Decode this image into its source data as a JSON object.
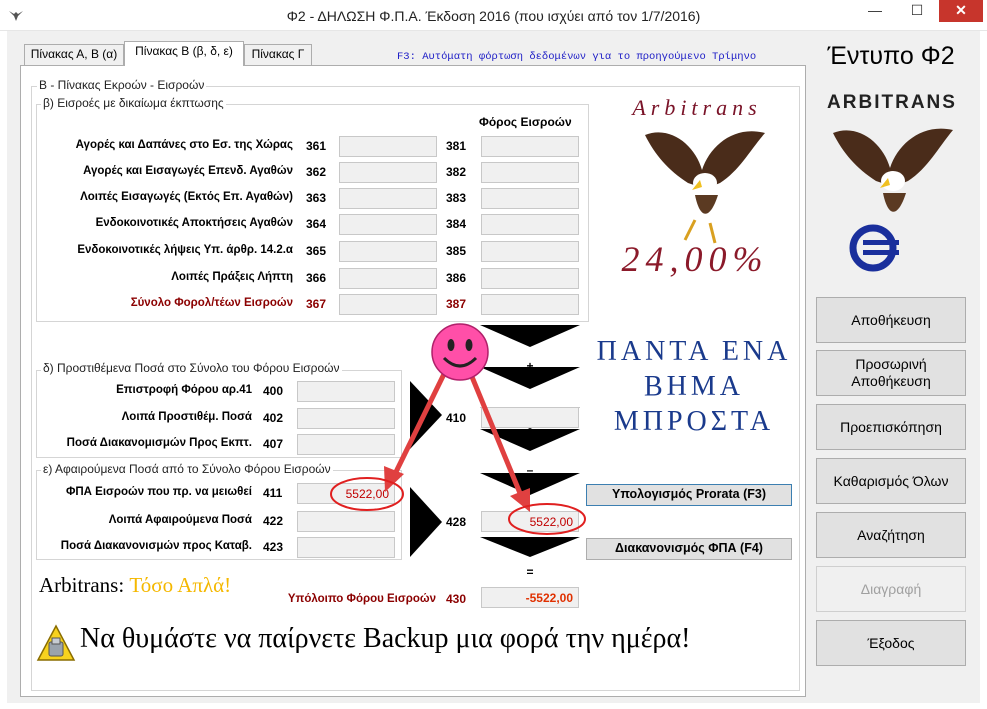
{
  "window": {
    "title": "Φ2 - ΔΗΛΩΣΗ Φ.Π.Α. Έκδοση 2016 (που ισχύει από τον 1/7/2016)",
    "minimize": "—",
    "maximize": "☐",
    "close": "✕"
  },
  "tabs": [
    {
      "label": "Πίνακας Α, Β (α)"
    },
    {
      "label": "Πίνακας Β (β, δ, ε)"
    },
    {
      "label": "Πίνακας Γ"
    }
  ],
  "hint": "F3: Αυτόματη φόρτωση δεδομένων για το προηγούμενο Τρίμηνο",
  "form_title": "Έντυπο Φ2",
  "brand": "ARBITRANS",
  "main_group_label": "Β - Πίνακας Εκροών - Εισροών",
  "section_b": {
    "label": "β) Εισροές με δικαίωμα έκπτωσης",
    "tax_header": "Φόρος Εισροών",
    "rows": [
      {
        "label": "Αγορές και Δαπάνες στο Εσ. της Χώρας",
        "code": "361",
        "value": "",
        "tax_code": "381",
        "tax": ""
      },
      {
        "label": "Αγορές και Εισαγωγές Επενδ. Αγαθών",
        "code": "362",
        "value": "",
        "tax_code": "382",
        "tax": ""
      },
      {
        "label": "Λοιπές Εισαγωγές (Εκτός Επ. Αγαθών)",
        "code": "363",
        "value": "",
        "tax_code": "383",
        "tax": ""
      },
      {
        "label": "Ενδοκοινοτικές Αποκτήσεις Αγαθών",
        "code": "364",
        "value": "",
        "tax_code": "384",
        "tax": ""
      },
      {
        "label": "Ενδοκοινοτικές λήψεις Υπ. άρθρ. 14.2.α",
        "code": "365",
        "value": "",
        "tax_code": "385",
        "tax": ""
      },
      {
        "label": "Λοιπές Πράξεις Λήπτη",
        "code": "366",
        "value": "",
        "tax_code": "386",
        "tax": ""
      }
    ],
    "total": {
      "label": "Σύνολο Φορολ/τέων Εισροών",
      "code": "367",
      "value": "",
      "tax_code": "387",
      "tax": ""
    }
  },
  "section_d": {
    "label": "δ) Προστιθέμενα Ποσά στο Σύνολο του Φόρου Εισροών",
    "rows": [
      {
        "label": "Επιστροφή Φόρου αρ.41",
        "code": "400",
        "value": ""
      },
      {
        "label": "Λοιπά Προστιθέμ. Ποσά",
        "code": "402",
        "value": ""
      },
      {
        "label": "Ποσά Διακανομισμών Προς Εκπτ.",
        "code": "407",
        "value": ""
      }
    ],
    "sum_code": "410",
    "sum_value": ""
  },
  "section_e": {
    "label": "ε) Αφαιρούμενα Ποσά από το Σύνολο Φόρου Εισροών",
    "rows": [
      {
        "label": "ΦΠΑ Εισροών που πρ. να μειωθεί",
        "code": "411",
        "value": "5522,00"
      },
      {
        "label": "Λοιπά Αφαιρούμενα Ποσά",
        "code": "422",
        "value": ""
      },
      {
        "label": "Ποσά Διακανονισμών προς Καταβ.",
        "code": "423",
        "value": ""
      }
    ],
    "sum_code": "428",
    "sum_value": "5522,00"
  },
  "operators": {
    "plus": "+",
    "minus": "–",
    "equals": "="
  },
  "buttons_inline": {
    "prorata": "Υπολογισμός Prorata (F3)",
    "settlement": "Διακανονισμός ΦΠΑ (F4)"
  },
  "balance": {
    "label": "Υπόλοιπο Φόρου Εισροών",
    "code": "430",
    "value": "-5522,00"
  },
  "ad": {
    "logo_text": "Arbitrans",
    "rate": "24,00%",
    "slogan_line1": "ΠΑΝΤΑ ΕΝΑ",
    "slogan_line2": "ΒΗΜΑ",
    "slogan_line3": "ΜΠΡΟΣΤΑ",
    "tagline_a": "Arbitrans:",
    "tagline_b": "Τόσο Απλά!",
    "backup": "Να θυμάστε να παίρνετε Backup μια φορά την ημέρα!"
  },
  "side_buttons": [
    {
      "label": "Αποθήκευση",
      "enabled": true
    },
    {
      "label": "Προσωρινή Αποθήκευση",
      "enabled": true
    },
    {
      "label": "Προεπισκόπηση",
      "enabled": true
    },
    {
      "label": "Καθαρισμός Όλων",
      "enabled": true
    },
    {
      "label": "Αναζήτηση",
      "enabled": true
    },
    {
      "label": "Διαγραφή",
      "enabled": false
    },
    {
      "label": "Έξοδος",
      "enabled": true
    }
  ],
  "colors": {
    "accent_red": "#8b0000",
    "value_red": "#c00000",
    "slogan_blue": "#1a3a8c",
    "annotation_red": "#e02020"
  }
}
